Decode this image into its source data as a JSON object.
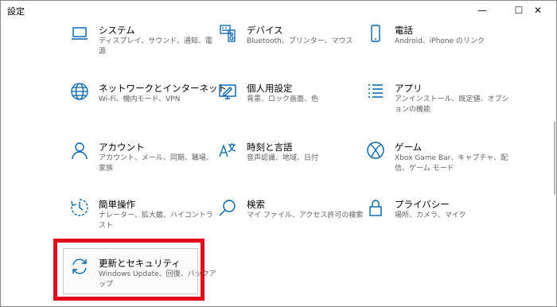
{
  "window": {
    "title": "設定",
    "minimize_glyph": "—",
    "maximize_glyph": "☐",
    "close_glyph": "✕"
  },
  "accent_color": "#0063b1",
  "highlight_color": "#e00d1a",
  "tiles": [
    {
      "label": "システム",
      "desc": "ディスプレイ、サウンド、通知、電源",
      "icon": "laptop-icon"
    },
    {
      "label": "デバイス",
      "desc": "Bluetooth、プリンター、マウス",
      "icon": "keyboard-icon"
    },
    {
      "label": "電話",
      "desc": "Android、iPhone のリンク",
      "icon": "phone-icon"
    },
    {
      "label": "ネットワークとインターネット",
      "desc": "Wi-Fi、機内モード、VPN",
      "icon": "globe-icon"
    },
    {
      "label": "個人用設定",
      "desc": "背景、ロック画面、色",
      "icon": "personalization-icon"
    },
    {
      "label": "アプリ",
      "desc": "アンインストール、既定値、オプションの機能",
      "icon": "apps-list-icon"
    },
    {
      "label": "アカウント",
      "desc": "アカウント、メール、同期、職場、家族",
      "icon": "person-icon"
    },
    {
      "label": "時刻と言語",
      "desc": "音声認識、地域、日付",
      "icon": "time-language-icon"
    },
    {
      "label": "ゲーム",
      "desc": "Xbox Game Bar、キャプチャ、配信、ゲーム モード",
      "icon": "xbox-icon"
    },
    {
      "label": "簡単操作",
      "desc": "ナレーター、拡大鏡、ハイコントラスト",
      "icon": "ease-of-access-icon"
    },
    {
      "label": "検索",
      "desc": "マイ ファイル、アクセス許可の検索",
      "icon": "search-icon"
    },
    {
      "label": "プライバシー",
      "desc": "場所、カメラ、マイク",
      "icon": "lock-icon"
    },
    {
      "label": "更新とセキュリティ",
      "desc": "Windows Update、回復、バックアップ",
      "icon": "update-icon"
    }
  ]
}
